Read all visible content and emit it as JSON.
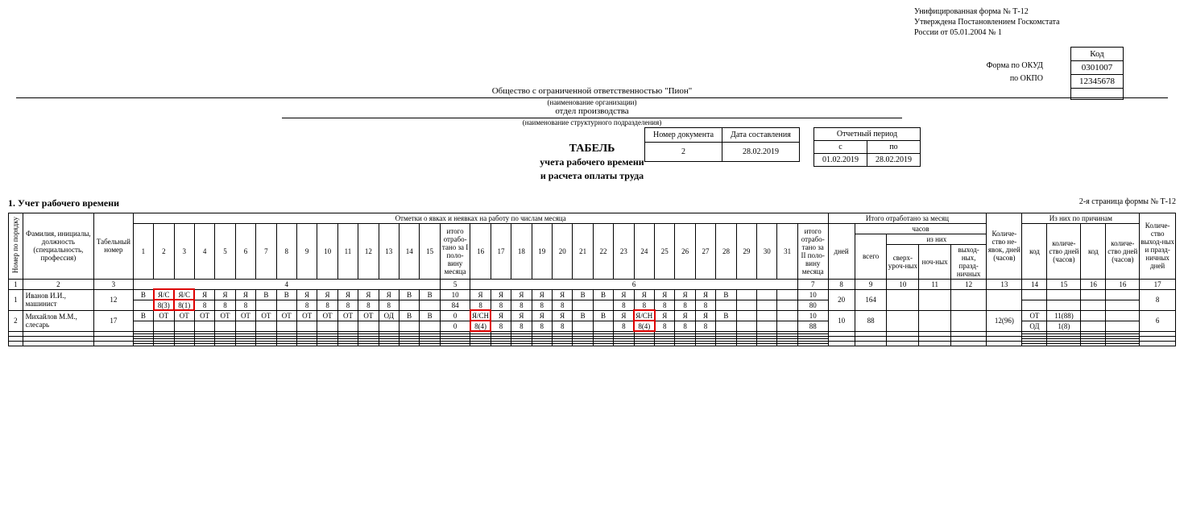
{
  "form_info": {
    "l1": "Унифицированная форма № Т-12",
    "l2": "Утверждена Постановлением Госкомстата",
    "l3": "России от 05.01.2004 № 1"
  },
  "codebox": {
    "h": "Код",
    "okud_label": "Форма по ОКУД",
    "okud": "0301007",
    "okpo_label": "по ОКПО",
    "okpo": "12345678"
  },
  "org": {
    "name": "Общество с ограниченной ответственностью \"Пион\"",
    "name_sub": "(наименование организации)",
    "dept": "отдел производства",
    "dept_sub": "(наименование структурного подразделения)"
  },
  "title": {
    "main": "ТАБЕЛЬ",
    "l2": "учета рабочего времени",
    "l3": "и расчета оплаты  труда"
  },
  "docmeta": {
    "num_h": "Номер документа",
    "date_h": "Дата составления",
    "num": "2",
    "date": "28.02.2019"
  },
  "period": {
    "h": "Отчетный период",
    "from_h": "с",
    "to_h": "по",
    "from": "01.02.2019",
    "to": "28.02.2019"
  },
  "section_title": "1. Учет рабочего времени",
  "page_note": "2-я страница формы № Т-12",
  "hdr": {
    "c1": "Номер по порядку",
    "c2": "Фамилия, инициалы, должность (специальность, профессия)",
    "c3": "Табельный номер",
    "marks": "Отметки о явках и неявках на работу по числам месяца",
    "half1": "итого отрабо-тано за I поло-вину месяца",
    "half2": "итого отрабо-тано за II поло-вину месяца",
    "tot": "Итого отработано за месяц",
    "days": "дней",
    "hours": "часов",
    "total": "всего",
    "ofthem": "из них",
    "over": "сверх-уроч-ных",
    "night": "ноч-ных",
    "hol": "выход-ных, празд-ничных",
    "abs": "Количе-ство не-явок, дней (часов)",
    "reasons": "Из них по причинам",
    "code": "код",
    "qty": "количе-ство дней (часов)",
    "off": "Количе-ство выход-ных и празд-ничных дней"
  },
  "colnums": {
    "c1": "1",
    "c2": "2",
    "c3": "3",
    "c4": "4",
    "c5": "5",
    "c6": "6",
    "c7": "7",
    "c8": "8",
    "c9": "9",
    "c10": "10",
    "c11": "11",
    "c12": "12",
    "c13": "13",
    "c14": "14",
    "c15": "15",
    "c16": "16",
    "c17": "17"
  },
  "days1": [
    "1",
    "2",
    "3",
    "4",
    "5",
    "6",
    "7",
    "8",
    "9",
    "10",
    "11",
    "12",
    "13",
    "14",
    "15"
  ],
  "days2": [
    "16",
    "17",
    "18",
    "19",
    "20",
    "21",
    "22",
    "23",
    "24",
    "25",
    "26",
    "27",
    "28",
    "29",
    "30",
    "31"
  ],
  "rows": [
    {
      "num": "1",
      "name": "Иванов И.И., машинист",
      "tab": "12",
      "m1": [
        "В",
        "Я/С",
        "Я/С",
        "Я",
        "Я",
        "Я",
        "В",
        "В",
        "Я",
        "Я",
        "Я",
        "Я",
        "Я",
        "В",
        "В"
      ],
      "h1": [
        "",
        "8(3)",
        "8(1)",
        "8",
        "8",
        "8",
        "",
        "",
        "8",
        "8",
        "8",
        "8",
        "8",
        "",
        ""
      ],
      "sum1_top": "10",
      "sum1_bot": "84",
      "m2": [
        "Я",
        "Я",
        "Я",
        "Я",
        "Я",
        "В",
        "В",
        "Я",
        "Я",
        "Я",
        "Я",
        "Я",
        "В",
        "",
        "",
        ""
      ],
      "h2": [
        "8",
        "8",
        "8",
        "8",
        "8",
        "",
        "",
        "8",
        "8",
        "8",
        "8",
        "8",
        "",
        "",
        "",
        ""
      ],
      "sum2_top": "10",
      "sum2_bot": "80",
      "days": "20",
      "hours": "164",
      "over": "",
      "night": "",
      "hol": "",
      "abs": "",
      "r1c": "",
      "r1q": "",
      "r2c": "",
      "r2q": "",
      "off": "8",
      "hl_m1": [
        1,
        2
      ],
      "hl_h1": [
        1,
        2
      ],
      "hl_m2": [],
      "hl_h2": []
    },
    {
      "num": "2",
      "name": "Михайлов М.М., слесарь",
      "tab": "17",
      "m1": [
        "В",
        "ОТ",
        "ОТ",
        "ОТ",
        "ОТ",
        "ОТ",
        "ОТ",
        "ОТ",
        "ОТ",
        "ОТ",
        "ОТ",
        "ОТ",
        "ОД",
        "В",
        "В"
      ],
      "h1": [
        "",
        "",
        "",
        "",
        "",
        "",
        "",
        "",
        "",
        "",
        "",
        "",
        "",
        "",
        ""
      ],
      "sum1_top": "0",
      "sum1_bot": "0",
      "m2": [
        "Я/СН",
        "Я",
        "Я",
        "Я",
        "Я",
        "В",
        "В",
        "Я",
        "Я/СН",
        "Я",
        "Я",
        "Я",
        "В",
        "",
        "",
        ""
      ],
      "h2": [
        "8(4)",
        "8",
        "8",
        "8",
        "8",
        "",
        "",
        "8",
        "8(4)",
        "8",
        "8",
        "8",
        "",
        "",
        "",
        ""
      ],
      "sum2_top": "10",
      "sum2_bot": "88",
      "days": "10",
      "hours": "88",
      "over": "",
      "night": "",
      "hol": "",
      "abs": "12(96)",
      "r1c": "ОТ",
      "r1q": "11(88)",
      "r2c": "ОД",
      "r2q": "1(8)",
      "off": "6",
      "hl_m1": [],
      "hl_h1": [],
      "hl_m2": [
        0,
        8
      ],
      "hl_h2": [
        0,
        8
      ]
    }
  ]
}
